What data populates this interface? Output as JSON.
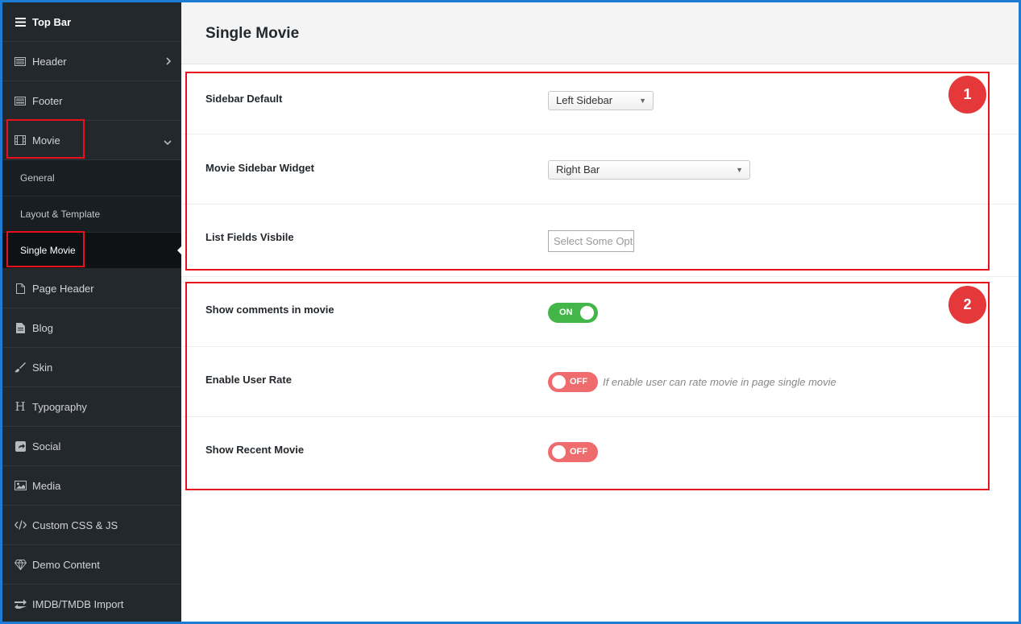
{
  "sidebar": {
    "top_item": {
      "label": "Top Bar",
      "icon": "menu-icon"
    },
    "items": [
      {
        "label": "Header",
        "icon": "header-icon"
      },
      {
        "label": "Footer",
        "icon": "footer-icon"
      },
      {
        "label": "Movie",
        "icon": "film-icon"
      },
      {
        "label": "Page Header",
        "icon": "page-icon"
      },
      {
        "label": "Blog",
        "icon": "document-icon"
      },
      {
        "label": "Skin",
        "icon": "brush-icon"
      },
      {
        "label": "Typography",
        "icon": "typography-icon"
      },
      {
        "label": "Social",
        "icon": "social-icon"
      },
      {
        "label": "Media",
        "icon": "image-icon"
      },
      {
        "label": "Custom CSS & JS",
        "icon": "code-icon"
      },
      {
        "label": "Demo Content",
        "icon": "diamond-icon"
      },
      {
        "label": "IMDB/TMDB Import",
        "icon": "import-icon"
      }
    ],
    "movie_sub": [
      {
        "label": "General"
      },
      {
        "label": "Layout & Template"
      },
      {
        "label": "Single Movie"
      }
    ]
  },
  "main": {
    "title": "Single Movie",
    "settings": {
      "sidebar_default": {
        "label": "Sidebar Default",
        "value": "Left Sidebar"
      },
      "movie_sidebar_widget": {
        "label": "Movie Sidebar Widget",
        "value": "Right Bar"
      },
      "list_fields_visible": {
        "label": "List Fields Visbile",
        "placeholder": "Select Some Options"
      },
      "show_comments": {
        "label": "Show comments in movie",
        "state": "ON"
      },
      "enable_user_rate": {
        "label": "Enable User Rate",
        "state": "OFF",
        "hint": "If enable user can rate movie in page single movie"
      },
      "show_recent_movie": {
        "label": "Show Recent Movie",
        "state": "OFF"
      }
    }
  },
  "annotations": {
    "badge_1": "1",
    "badge_2": "2"
  },
  "colors": {
    "frame": "#1e7bd4",
    "highlight": "#e8101a",
    "toggle_on": "#44b549",
    "toggle_off": "#ee6b6e",
    "sidebar_bg": "#23282d"
  }
}
